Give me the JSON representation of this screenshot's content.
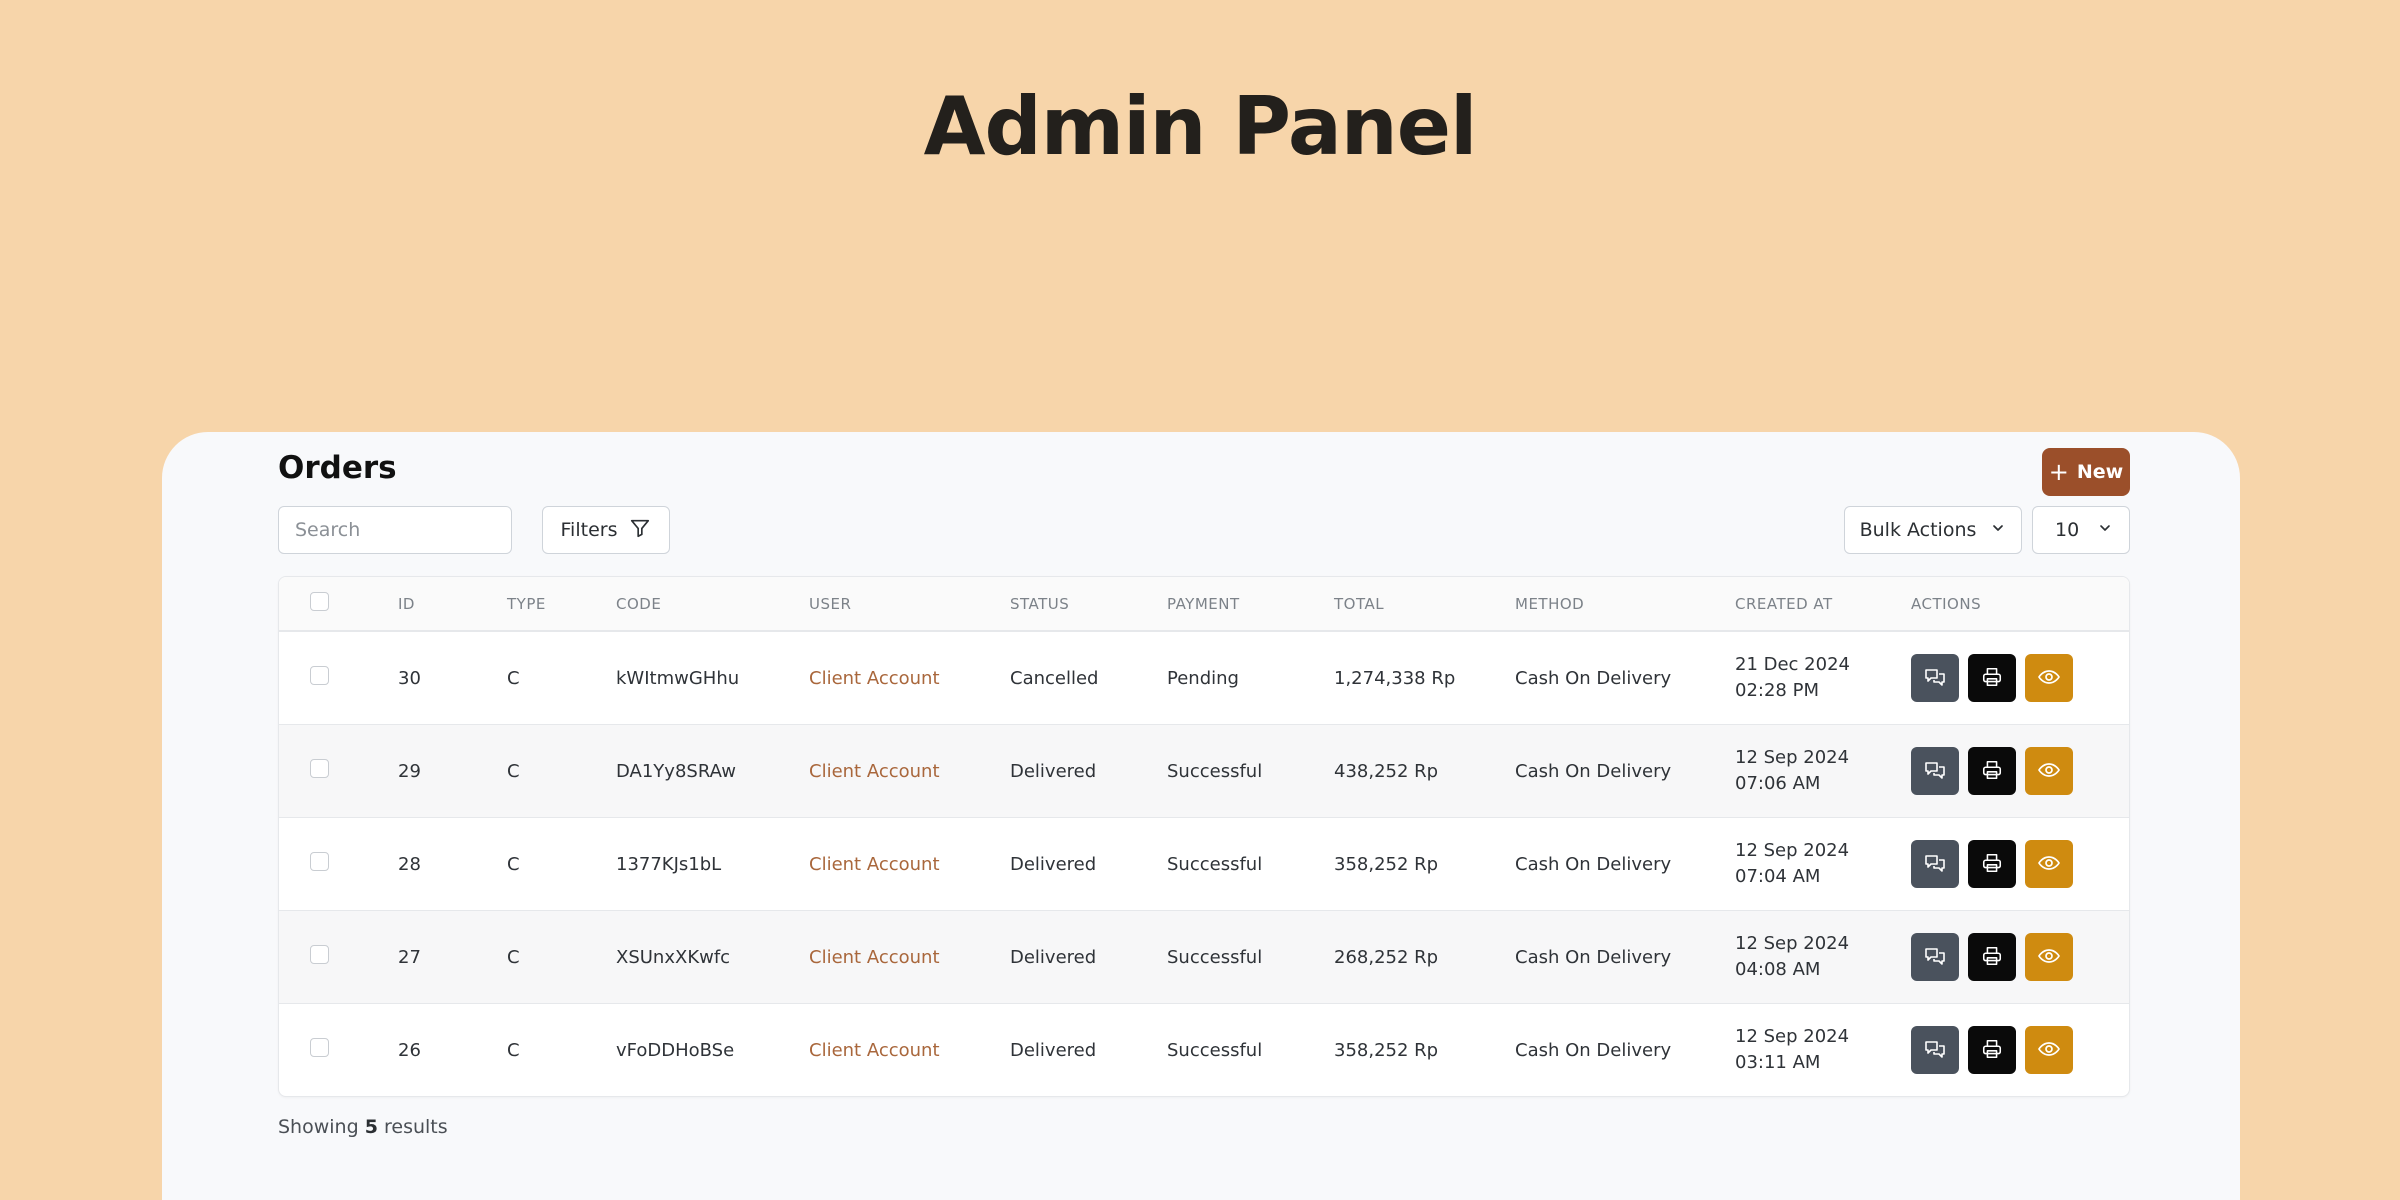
{
  "hero": {
    "title": "Admin Panel"
  },
  "orders": {
    "title": "Orders",
    "new_label": "New",
    "search_placeholder": "Search",
    "filters_label": "Filters",
    "bulk_label": "Bulk Actions",
    "per_page": "10"
  },
  "table": {
    "headers": {
      "id": "ID",
      "type": "TYPE",
      "code": "CODE",
      "user": "USER",
      "status": "STATUS",
      "payment": "PAYMENT",
      "total": "TOTAL",
      "method": "METHOD",
      "created": "CREATED AT",
      "actions": "ACTIONS"
    },
    "rows": [
      {
        "id": "30",
        "type": "C",
        "code": "kWItmwGHhu",
        "user": "Client Account",
        "status": "Cancelled",
        "payment": "Pending",
        "total": "1,274,338 Rp",
        "method": "Cash On Delivery",
        "date": "21 Dec 2024",
        "time": "02:28 PM"
      },
      {
        "id": "29",
        "type": "C",
        "code": "DA1Yy8SRAw",
        "user": "Client Account",
        "status": "Delivered",
        "payment": "Successful",
        "total": "438,252 Rp",
        "method": "Cash On Delivery",
        "date": "12 Sep 2024",
        "time": "07:06 AM"
      },
      {
        "id": "28",
        "type": "C",
        "code": "1377KJs1bL",
        "user": "Client Account",
        "status": "Delivered",
        "payment": "Successful",
        "total": "358,252 Rp",
        "method": "Cash On Delivery",
        "date": "12 Sep 2024",
        "time": "07:04 AM"
      },
      {
        "id": "27",
        "type": "C",
        "code": "XSUnxXKwfc",
        "user": "Client Account",
        "status": "Delivered",
        "payment": "Successful",
        "total": "268,252 Rp",
        "method": "Cash On Delivery",
        "date": "12 Sep 2024",
        "time": "04:08 AM"
      },
      {
        "id": "26",
        "type": "C",
        "code": "vFoDDHoBSe",
        "user": "Client Account",
        "status": "Delivered",
        "payment": "Successful",
        "total": "358,252 Rp",
        "method": "Cash On Delivery",
        "date": "12 Sep 2024",
        "time": "03:11 AM"
      }
    ]
  },
  "footer": {
    "prefix": "Showing",
    "count": "5",
    "suffix": "results"
  },
  "colors": {
    "background": "#f7d5aa",
    "card": "#f8f9fb",
    "new_button": "#9b4f2a",
    "user_link": "#a9673c",
    "chat_button": "#4a525d",
    "print_button": "#0a0a0a",
    "view_button": "#cf8b10"
  },
  "icons": {
    "new": "plus-icon",
    "filters": "funnel-icon",
    "bulk": "chevron-down-icon",
    "per_page": "chevron-down-icon",
    "chat": "chat-bubbles-icon",
    "print": "printer-icon",
    "view": "eye-icon"
  }
}
